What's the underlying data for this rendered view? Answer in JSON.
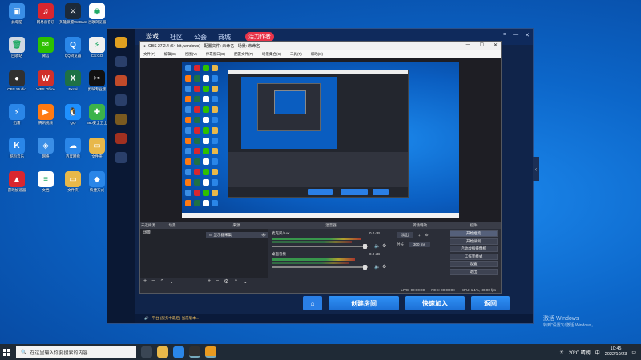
{
  "desktop": {
    "icons": [
      {
        "label": "此电脑",
        "color": "#3a8ee6",
        "glyph": "▣"
      },
      {
        "label": "网易云音乐",
        "color": "#d9262f",
        "glyph": "♫"
      },
      {
        "label": "英雄联盟WeGame版",
        "color": "#1c2a3a",
        "glyph": "⚔"
      },
      {
        "label": "谷歌浏览器",
        "color": "#ffffff",
        "glyph": "◉"
      },
      {
        "label": "回收站",
        "color": "#cfd8e3",
        "glyph": "🗑"
      },
      {
        "label": "微信",
        "color": "#2dc100",
        "glyph": "✉"
      },
      {
        "label": "QQ浏览器",
        "color": "#2a86e8",
        "glyph": "Q"
      },
      {
        "label": "CS:GO",
        "color": "#f0f0f0",
        "glyph": "⚡"
      },
      {
        "label": "OBS Studio",
        "color": "#303030",
        "glyph": "●"
      },
      {
        "label": "WPS Office",
        "color": "#d0302a",
        "glyph": "W"
      },
      {
        "label": "Excel",
        "color": "#1e7145",
        "glyph": "X"
      },
      {
        "label": "剪映专业版",
        "color": "#111111",
        "glyph": "✂"
      },
      {
        "label": "迅雷",
        "color": "#2a86e8",
        "glyph": "⚡"
      },
      {
        "label": "腾讯视频",
        "color": "#ff7a12",
        "glyph": "▶"
      },
      {
        "label": "QQ",
        "color": "#1e90ff",
        "glyph": "🐧"
      },
      {
        "label": "360安全卫士",
        "color": "#3cb34a",
        "glyph": "✚"
      },
      {
        "label": "酷狗音乐",
        "color": "#2a86e8",
        "glyph": "K"
      },
      {
        "label": "网络",
        "color": "#3a8ee6",
        "glyph": "◈"
      },
      {
        "label": "百度网盘",
        "color": "#2a86e8",
        "glyph": "☁"
      },
      {
        "label": "文件夹",
        "color": "#e8b84a",
        "glyph": "▭"
      },
      {
        "label": "游戏加速器",
        "color": "#d9262f",
        "glyph": "▲"
      },
      {
        "label": "文档",
        "color": "#ffffff",
        "glyph": "≡"
      },
      {
        "label": "文件夹",
        "color": "#e8b84a",
        "glyph": "▭"
      },
      {
        "label": "快捷方式",
        "color": "#2a86e8",
        "glyph": "◆"
      }
    ]
  },
  "launcher": {
    "tabs": [
      "游戏",
      "社区",
      "公会",
      "商城"
    ],
    "ad_label": "活力作者",
    "buttons": {
      "home": "⌂",
      "create": "创建房间",
      "quick": "快速加入",
      "back": "返回"
    },
    "notice": "平台 (服务中最后)  当前版本..."
  },
  "obs": {
    "title": "OBS 27.2.4 (64-bit, windows) - 配置文件: 未命名 - 场景: 未命名",
    "menu": [
      "文件(F)",
      "编辑(E)",
      "视图(V)",
      "停靠窗口(D)",
      "配置文件(P)",
      "场景集合(S)",
      "工具(T)",
      "帮助(H)"
    ],
    "panels": {
      "scenes": "场景",
      "sources": "来源",
      "mixer": "混音器",
      "transitions": "转场特效",
      "controls": "控件"
    },
    "scene_item": "场景",
    "source_item": "显示器采集",
    "mixer_channels": [
      {
        "name": "麦克风/Aux",
        "db": "0.0 dB",
        "level": 0.62
      },
      {
        "name": "桌面音频",
        "db": "0.0 dB",
        "level": 0.58
      }
    ],
    "transition": {
      "type": "淡出",
      "duration_label": "时长",
      "duration": "300 ms"
    },
    "controls": [
      "开始推流",
      "开始录制",
      "启动虚拟摄像机",
      "工作室模式",
      "设置",
      "退出"
    ],
    "status": {
      "live": "LIVE: 00:00:00",
      "rec": "REC: 00:00:00",
      "cpu": "CPU: 1.1%, 30.00 fps"
    },
    "scenes_label": "未选择源"
  },
  "watermark": {
    "line1": "激活 Windows",
    "line2": "转到\"设置\"以激活 Windows。"
  },
  "taskbar": {
    "search_placeholder": "在这里输入你要搜索的内容",
    "weather": "20°C 晴朗",
    "time": "10:45",
    "date": "2022/10/23",
    "ime": "中"
  }
}
